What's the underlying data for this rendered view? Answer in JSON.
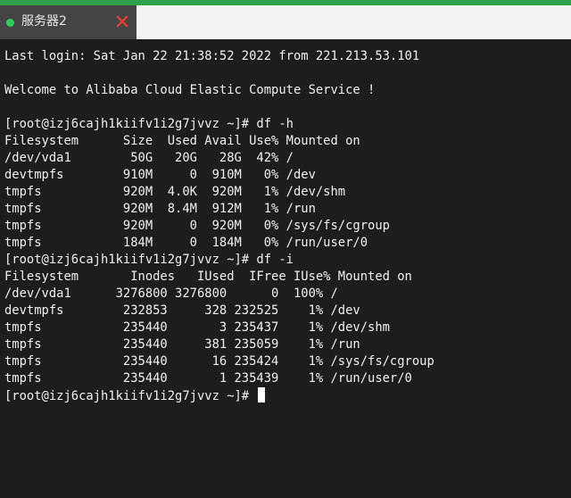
{
  "tab": {
    "label": "服务器2",
    "status_color": "#2fd05a",
    "close_icon": "close-icon",
    "close_color": "#e23b3b"
  },
  "terminal": {
    "lines": [
      "Last login: Sat Jan 22 21:38:52 2022 from 221.213.53.101",
      "",
      "Welcome to Alibaba Cloud Elastic Compute Service !",
      "",
      "[root@izj6cajh1kiifv1i2g7jvvz ~]# df -h",
      "Filesystem      Size  Used Avail Use% Mounted on",
      "/dev/vda1        50G   20G   28G  42% /",
      "devtmpfs        910M     0  910M   0% /dev",
      "tmpfs           920M  4.0K  920M   1% /dev/shm",
      "tmpfs           920M  8.4M  912M   1% /run",
      "tmpfs           920M     0  920M   0% /sys/fs/cgroup",
      "tmpfs           184M     0  184M   0% /run/user/0",
      "[root@izj6cajh1kiifv1i2g7jvvz ~]# df -i",
      "Filesystem       Inodes   IUsed  IFree IUse% Mounted on",
      "/dev/vda1      3276800 3276800      0  100% /",
      "devtmpfs        232853     328 232525    1% /dev",
      "tmpfs           235440       3 235437    1% /dev/shm",
      "tmpfs           235440     381 235059    1% /run",
      "tmpfs           235440      16 235424    1% /sys/fs/cgroup",
      "tmpfs           235440       1 235439    1% /run/user/0",
      "[root@izj6cajh1kiifv1i2g7jvvz ~]# "
    ]
  }
}
